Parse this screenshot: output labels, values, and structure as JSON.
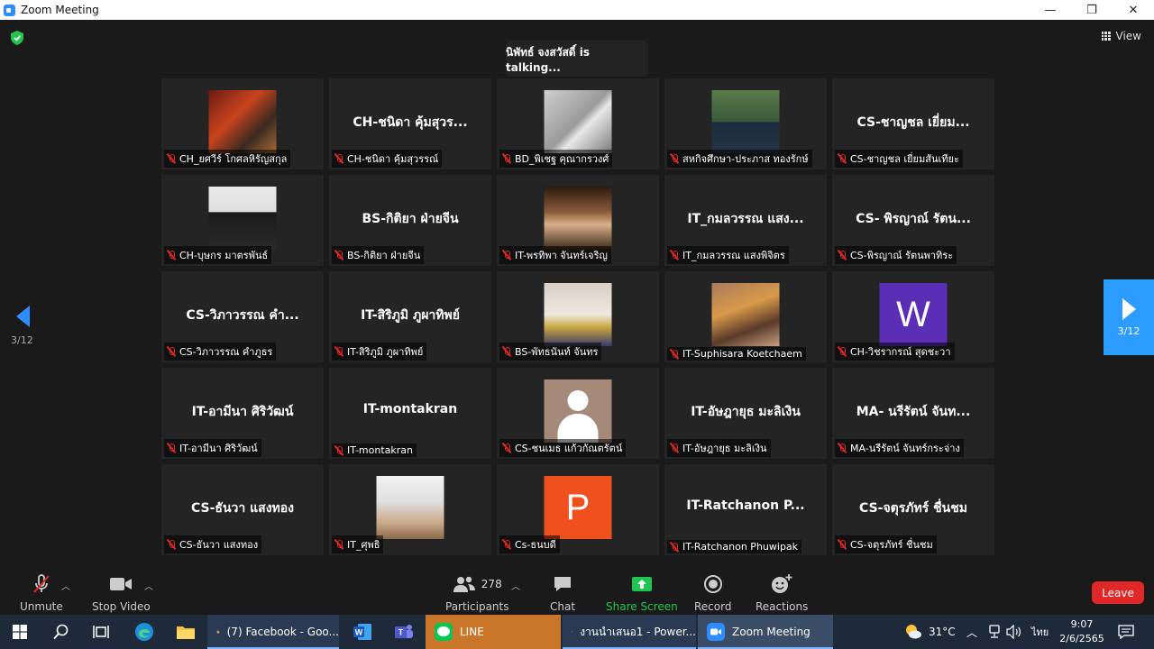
{
  "window": {
    "title": "Zoom Meeting",
    "minimize": "—",
    "restore": "❐",
    "close": "✕"
  },
  "talking": "นิพัทธ์ จงสวัสดิ์ is talking...",
  "view_label": "View",
  "pager": {
    "left": "3/12",
    "right": "3/12"
  },
  "tiles": [
    {
      "big": "",
      "name": "CH_ยศวีร์ โกศลหิรัญสกุล",
      "avatar": "photo1"
    },
    {
      "big": "CH-ชนิดา คุ้มสุวร...",
      "name": "CH-ชนิดา คุ้มสุวรรณ์",
      "avatar": ""
    },
    {
      "big": "",
      "name": "BD_พิเชฐ  คุณากรวงศ์",
      "avatar": "photo3"
    },
    {
      "big": "",
      "name": "สหกิจศึกษา-ประภาส ทองรักษ์",
      "avatar": "photo3b"
    },
    {
      "big": "CS-ชาญชล เยี่ยม...",
      "name": "CS-ชาญชล เยี่ยมสันเทียะ",
      "avatar": ""
    },
    {
      "big": "",
      "name": "CH-บุษกร มาตรพันธ์",
      "avatar": "photo2"
    },
    {
      "big": "BS-กิติยา ฝ่ายจีน",
      "name": "BS-กิติยา ฝ่ายจีน",
      "avatar": ""
    },
    {
      "big": "",
      "name": "IT-พรทิพา จันทร์เจริญ",
      "avatar": "photo5"
    },
    {
      "big": "IT_กมลวรรณ แสง...",
      "name": "IT_กมลวรรณ แสงพิจิตร",
      "avatar": ""
    },
    {
      "big": "CS- พิรญาณ์ รัตน...",
      "name": "CS-พิรญาณ์ รัตนพาทิระ",
      "avatar": ""
    },
    {
      "big": "CS-วิภาวรรณ คำ...",
      "name": "CS-วิภาวรรณ คำภูธร",
      "avatar": ""
    },
    {
      "big": "IT-สิริภูมิ ภูผาทิพย์",
      "name": "IT-สิริภูมิ ภูผาทิพย์",
      "avatar": ""
    },
    {
      "big": "",
      "name": "BS-พัทธนันท์ จันทร",
      "avatar": "photo6"
    },
    {
      "big": "",
      "name": "IT-Suphisara Koetchaem",
      "avatar": "photo7"
    },
    {
      "big": "",
      "name": "CH-วิชรากรณ์ สุดชะวา",
      "avatar": "letterW"
    },
    {
      "big": "IT-อามีนา ศิริวัฒน์",
      "name": "IT-อามีนา ศิริวัฒน์",
      "avatar": ""
    },
    {
      "big": "IT-montakran",
      "name": "IT-montakran",
      "avatar": ""
    },
    {
      "big": "",
      "name": "CS-ชนเมธ แก้วกัณตรัตน์",
      "avatar": "gray"
    },
    {
      "big": "IT-อัษฎายุธ มะลิเงิน",
      "name": "IT-อัษฎายุธ มะลิเงิน",
      "avatar": ""
    },
    {
      "big": "MA- นรีรัตน์ จันท...",
      "name": "MA-นรีรัตน์ จันทร์กระจ่าง",
      "avatar": ""
    },
    {
      "big": "CS-ธันวา แสงทอง",
      "name": "CS-ธันวา แสงทอง",
      "avatar": ""
    },
    {
      "big": "",
      "name": "IT_ศุพธิ",
      "avatar": "photo8"
    },
    {
      "big": "",
      "name": "Cs-ธนบดี",
      "avatar": "letterP"
    },
    {
      "big": "IT-Ratchanon  P...",
      "name": "IT-Ratchanon Phuwipak",
      "avatar": ""
    },
    {
      "big": "CS-จตุรภัทร์ ชื่นชม",
      "name": "CS-จตุรภัทร์ ชื่นชม",
      "avatar": ""
    }
  ],
  "letters": {
    "W": "W",
    "P": "P"
  },
  "colors": {
    "W": "#5b2fb5",
    "P": "#f0501e",
    "accent": "#2d8cff",
    "leave": "#e02828"
  },
  "toolbar": {
    "unmute": "Unmute",
    "stop_video": "Stop Video",
    "participants": "Participants",
    "participants_count": "278",
    "chat": "Chat",
    "share_screen": "Share Screen",
    "record": "Record",
    "reactions": "Reactions",
    "leave": "Leave"
  },
  "taskbar": {
    "apps": [
      {
        "label": "(7) Facebook - Goo..."
      },
      {
        "label": "LINE"
      },
      {
        "label": "งานนำเสนอ1 - Power..."
      },
      {
        "label": "Zoom Meeting"
      }
    ],
    "temperature": "31°C",
    "lang": "ไทย",
    "time": "9:07",
    "date": "2/6/2565"
  }
}
